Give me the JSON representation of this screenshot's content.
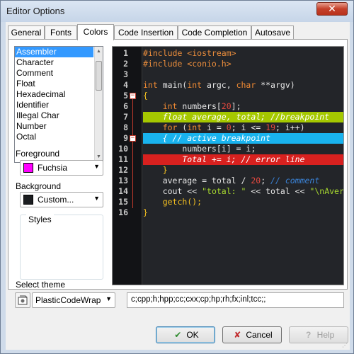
{
  "window": {
    "title": "Editor Options",
    "close_glyph": "✕"
  },
  "tabs": [
    {
      "label": "General"
    },
    {
      "label": "Fonts"
    },
    {
      "label": "Colors",
      "active": true
    },
    {
      "label": "Code Insertion"
    },
    {
      "label": "Code Completion"
    },
    {
      "label": "Autosave"
    }
  ],
  "element_list": {
    "items": [
      "Assembler",
      "Character",
      "Comment",
      "Float",
      "Hexadecimal",
      "Identifier",
      "Illegal Char",
      "Number",
      "Octal"
    ],
    "selected": "Assembler"
  },
  "foreground": {
    "label": "Foreground",
    "value": "Fuchsia",
    "color": "#ff00ff"
  },
  "background": {
    "label": "Background",
    "value": "Custom...",
    "color": "#1b1d20"
  },
  "styles": {
    "label": "Styles"
  },
  "editor": {
    "lines": [
      {
        "n": "1",
        "tokens": [
          [
            "pp",
            "#include <iostream>"
          ]
        ]
      },
      {
        "n": "2",
        "tokens": [
          [
            "pp",
            "#include <conio.h>"
          ]
        ]
      },
      {
        "n": "3",
        "tokens": []
      },
      {
        "n": "4",
        "tokens": [
          [
            "kw",
            "int"
          ],
          [
            "pl",
            " main("
          ],
          [
            "kw",
            "int"
          ],
          [
            "pl",
            " argc, "
          ],
          [
            "kw",
            "char"
          ],
          [
            "pl",
            " **argv)"
          ]
        ]
      },
      {
        "n": "5",
        "fold": true,
        "tokens": [
          [
            "op",
            "{"
          ]
        ]
      },
      {
        "n": "6",
        "tokens": [
          [
            "pl",
            "    "
          ],
          [
            "kw",
            "int"
          ],
          [
            "pl",
            " numbers["
          ],
          [
            "num",
            "20"
          ],
          [
            "pl",
            "];"
          ]
        ]
      },
      {
        "n": "7",
        "hl": "green",
        "tokens": [
          [
            "pl",
            "    float average, total; //breakpoint"
          ]
        ]
      },
      {
        "n": "8",
        "tokens": [
          [
            "pl",
            "    "
          ],
          [
            "kw",
            "for"
          ],
          [
            "pl",
            " ("
          ],
          [
            "kw",
            "int"
          ],
          [
            "pl",
            " i = "
          ],
          [
            "num",
            "0"
          ],
          [
            "pl",
            "; i <= "
          ],
          [
            "num",
            "19"
          ],
          [
            "pl",
            "; i++)"
          ]
        ]
      },
      {
        "n": "9",
        "fold": true,
        "hl": "blue",
        "tokens": [
          [
            "pl",
            "    { // active breakpoint"
          ]
        ]
      },
      {
        "n": "10",
        "tokens": [
          [
            "pl",
            "        numbers[i] = i;"
          ]
        ]
      },
      {
        "n": "11",
        "hl": "red",
        "tokens": [
          [
            "pl",
            "        Total += i; // error line"
          ]
        ]
      },
      {
        "n": "12",
        "tokens": [
          [
            "pl",
            "    "
          ],
          [
            "op",
            "}"
          ]
        ]
      },
      {
        "n": "13",
        "tokens": [
          [
            "pl",
            "    average = total / "
          ],
          [
            "num",
            "20"
          ],
          [
            "pl",
            "; "
          ],
          [
            "com",
            "// comment"
          ]
        ]
      },
      {
        "n": "14",
        "tokens": [
          [
            "pl",
            "    cout << "
          ],
          [
            "str",
            "\"total: \""
          ],
          [
            "pl",
            " << total << "
          ],
          [
            "str",
            "\"\\nAverage: \""
          ]
        ]
      },
      {
        "n": "15",
        "tokens": [
          [
            "pl",
            "    "
          ],
          [
            "fn",
            "getch();"
          ]
        ]
      },
      {
        "n": "16",
        "tokens": [
          [
            "op",
            "}"
          ]
        ]
      }
    ]
  },
  "theme": {
    "label": "Select theme",
    "value": "PlasticCodeWrap",
    "extensions": "c;cpp;h;hpp;cc;cxx;cp;hp;rh;fx;inl;tcc;;"
  },
  "buttons": {
    "ok": "OK",
    "ok_underline": "O",
    "cancel": "Cancel",
    "cancel_underline": "C",
    "help": "Help",
    "help_underline": "H"
  },
  "colors": {
    "accent": "#3399ff",
    "green_hl": "#a5c800",
    "blue_hl": "#19b3ee",
    "red_hl": "#d8211f"
  }
}
